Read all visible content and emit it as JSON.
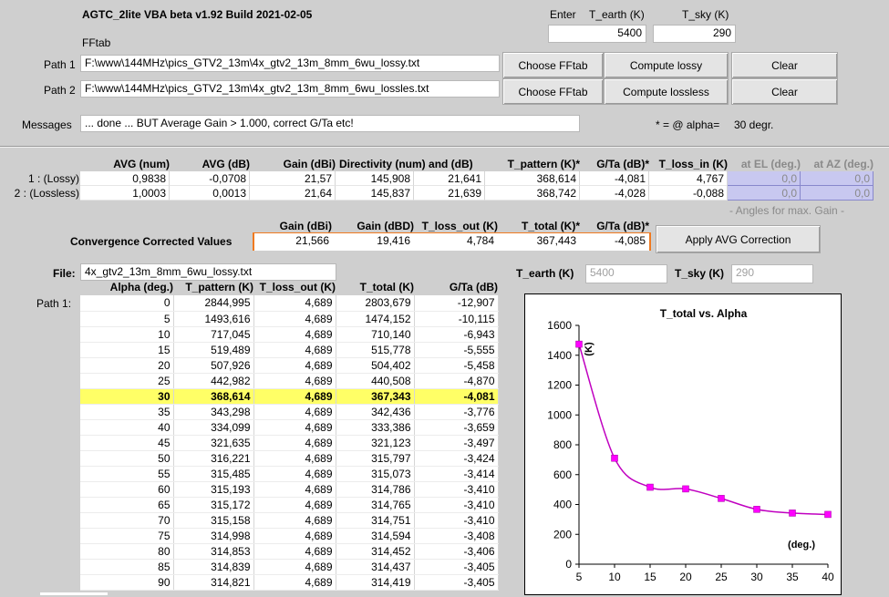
{
  "app": {
    "title": "AGTC_2lite VBA beta v1.92 Build 2021-02-05",
    "subtitle": "FFtab"
  },
  "temps": {
    "enter_label": "Enter",
    "t_earth_label": "T_earth (K)",
    "t_sky_label": "T_sky (K)",
    "t_earth_value": "5400",
    "t_sky_value": "290"
  },
  "paths": {
    "path1_label": "Path 1",
    "path1_value": "F:\\www\\144MHz\\pics_GTV2_13m\\4x_gtv2_13m_8mm_6wu_lossy.txt",
    "path2_label": "Path 2",
    "path2_value": "F:\\www\\144MHz\\pics_GTV2_13m\\4x_gtv2_13m_8mm_6wu_lossles.txt",
    "choose1": "Choose FFtab",
    "choose2": "Choose FFtab",
    "compute_lossy": "Compute lossy",
    "compute_lossless": "Compute lossless",
    "clear1": "Clear",
    "clear2": "Clear"
  },
  "messages": {
    "label": "Messages",
    "value": " ... done ... BUT Average Gain > 1.000, correct G/Ta etc!",
    "alpha_note": "* = @ alpha=",
    "alpha_value": "30 degr."
  },
  "summary": {
    "headers": [
      "AVG (num)",
      "AVG (dB)",
      "Gain (dBi)",
      "Directivity (num) and (dB)",
      "T_pattern (K)*",
      "G/Ta (dB)*",
      "T_loss_in (K)",
      "at EL (deg.)",
      "at AZ (deg.)"
    ],
    "rows": [
      {
        "label": "1 : (Lossy)",
        "avg_num": "0,9838",
        "avg_db": "-0,0708",
        "gain": "21,57",
        "dir_num": "145,908",
        "dir_db": "21,641",
        "t_pattern": "368,614",
        "gta": "-4,081",
        "t_loss_in": "4,767",
        "el": "0,0",
        "az": "0,0"
      },
      {
        "label": "2 : (Lossless)",
        "avg_num": "1,0003",
        "avg_db": "0,0013",
        "gain": "21,64",
        "dir_num": "145,837",
        "dir_db": "21,639",
        "t_pattern": "368,742",
        "gta": "-4,028",
        "t_loss_in": "-0,088",
        "el": "0,0",
        "az": "0,0"
      }
    ],
    "angles_note": "-  Angles for max. Gain  -"
  },
  "convergence": {
    "label": "Convergence Corrected Values",
    "headers": [
      "Gain (dBi)",
      "Gain (dBD)",
      "T_loss_out (K)",
      "T_total (K)*",
      "G/Ta (dB)*"
    ],
    "values": [
      "21,566",
      "19,416",
      "4,784",
      "367,443",
      "-4,085"
    ],
    "apply_button": "Apply AVG Correction"
  },
  "file": {
    "label": "File:",
    "value": "4x_gtv2_13m_8mm_6wu_lossy.txt",
    "t_earth_label": "T_earth (K)",
    "t_earth_value": "5400",
    "t_sky_label": "T_sky (K)",
    "t_sky_value": "290"
  },
  "path_table": {
    "row_label": "Path 1:",
    "headers": [
      "Alpha (deg.)",
      "T_pattern (K)",
      "T_loss_out (K)",
      "T_total (K)",
      "G/Ta (dB)"
    ],
    "rows": [
      [
        "0",
        "2844,995",
        "4,689",
        "2803,679",
        "-12,907"
      ],
      [
        "5",
        "1493,616",
        "4,689",
        "1474,152",
        "-10,115"
      ],
      [
        "10",
        "717,045",
        "4,689",
        "710,140",
        "-6,943"
      ],
      [
        "15",
        "519,489",
        "4,689",
        "515,778",
        "-5,555"
      ],
      [
        "20",
        "507,926",
        "4,689",
        "504,402",
        "-5,458"
      ],
      [
        "25",
        "442,982",
        "4,689",
        "440,508",
        "-4,870"
      ],
      [
        "30",
        "368,614",
        "4,689",
        "367,343",
        "-4,081"
      ],
      [
        "35",
        "343,298",
        "4,689",
        "342,436",
        "-3,776"
      ],
      [
        "40",
        "334,099",
        "4,689",
        "333,386",
        "-3,659"
      ],
      [
        "45",
        "321,635",
        "4,689",
        "321,123",
        "-3,497"
      ],
      [
        "50",
        "316,221",
        "4,689",
        "315,797",
        "-3,424"
      ],
      [
        "55",
        "315,485",
        "4,689",
        "315,073",
        "-3,414"
      ],
      [
        "60",
        "315,193",
        "4,689",
        "314,786",
        "-3,410"
      ],
      [
        "65",
        "315,172",
        "4,689",
        "314,765",
        "-3,410"
      ],
      [
        "70",
        "315,158",
        "4,689",
        "314,751",
        "-3,410"
      ],
      [
        "75",
        "314,998",
        "4,689",
        "314,594",
        "-3,408"
      ],
      [
        "80",
        "314,853",
        "4,689",
        "314,452",
        "-3,406"
      ],
      [
        "85",
        "314,839",
        "4,689",
        "314,437",
        "-3,405"
      ],
      [
        "90",
        "314,821",
        "4,689",
        "314,419",
        "-3,405"
      ]
    ],
    "highlight_index": 6,
    "highlight_color": "#ffff66"
  },
  "chart_data": {
    "type": "line",
    "title": "T_total vs. Alpha",
    "xlabel": "(deg.)",
    "ylabel": "(K)",
    "x": [
      5,
      10,
      15,
      20,
      25,
      30,
      35,
      40
    ],
    "y": [
      1474.152,
      710.14,
      515.778,
      504.402,
      440.508,
      367.343,
      342.436,
      333.386
    ],
    "xlim": [
      5,
      40
    ],
    "ylim": [
      0,
      1600
    ],
    "xticks": [
      5,
      10,
      15,
      20,
      25,
      30,
      35,
      40
    ],
    "yticks": [
      0,
      200,
      400,
      600,
      800,
      1000,
      1200,
      1400,
      1600
    ],
    "line_color": "#c000c0",
    "marker_color": "#ff00ff",
    "smoothed": true,
    "grid": false
  }
}
